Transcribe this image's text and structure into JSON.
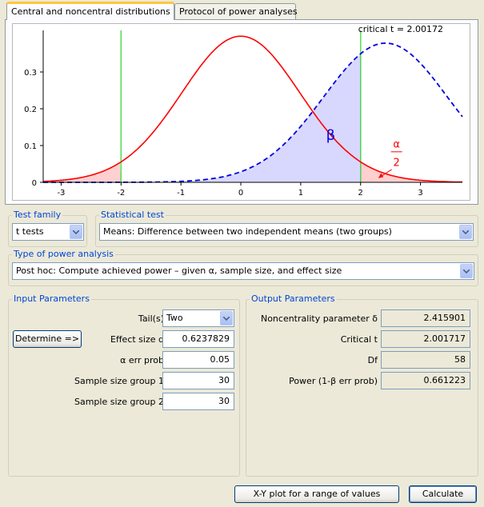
{
  "tabs": [
    {
      "label": "Central and noncentral distributions",
      "active": true
    },
    {
      "label": "Protocol of power analyses",
      "active": false
    }
  ],
  "plot": {
    "critical_label": "critical t = 2.00172",
    "beta_label": "β",
    "alpha_numer": "α",
    "alpha_denom": "2",
    "x_ticks": [
      "-3",
      "-2",
      "-1",
      "0",
      "1",
      "2",
      "3"
    ],
    "y_ticks": [
      "0",
      "0.1",
      "0.2",
      "0.3"
    ],
    "colors": {
      "central": "#ff0000",
      "noncentral": "#0000dd",
      "critical": "#00cc00",
      "beta_fill": "#d8d8ff",
      "alpha_fill": "#ffd0d0"
    }
  },
  "chart_data": {
    "type": "line",
    "series": [],
    "x_range": [
      -3.3,
      3.7
    ],
    "y_range": [
      0,
      0.4
    ],
    "critical_t": 2.00172,
    "noncentrality": 2.415901,
    "df": 58,
    "x_ticks": [
      -3,
      -2,
      -1,
      0,
      1,
      2,
      3
    ],
    "y_ticks": [
      0,
      0.1,
      0.2,
      0.3
    ],
    "annotations": [
      "critical t = 2.00172",
      "β",
      "α/2"
    ]
  },
  "test_family": {
    "legend": "Test family",
    "value": "t tests"
  },
  "statistical_test": {
    "legend": "Statistical test",
    "value": "Means: Difference between two independent means (two groups)"
  },
  "power_type": {
    "legend": "Type of power analysis",
    "value": "Post hoc: Compute achieved power – given α, sample size, and effect size"
  },
  "input": {
    "legend": "Input Parameters",
    "determine_label": "Determine =>",
    "tails": {
      "label": "Tail(s)",
      "value": "Two"
    },
    "effect": {
      "label": "Effect size d",
      "value": "0.6237829"
    },
    "alpha": {
      "label": "α err prob",
      "value": "0.05"
    },
    "n1": {
      "label": "Sample size group 1",
      "value": "30"
    },
    "n2": {
      "label": "Sample size group 2",
      "value": "30"
    }
  },
  "output": {
    "legend": "Output Parameters",
    "ncp": {
      "label": "Noncentrality parameter δ",
      "value": "2.415901"
    },
    "crit": {
      "label": "Critical t",
      "value": "2.001717"
    },
    "df": {
      "label": "Df",
      "value": "58"
    },
    "power": {
      "label": "Power (1-β err prob)",
      "value": "0.661223"
    }
  },
  "buttons": {
    "xy_plot": "X-Y plot for a range of values",
    "calculate": "Calculate"
  }
}
